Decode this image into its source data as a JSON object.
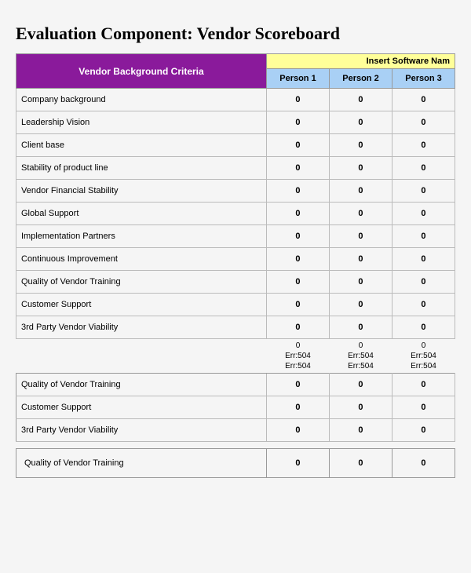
{
  "title": "Evaluation Component: Vendor Scoreboard",
  "header": {
    "criteria_label": "Vendor Background Criteria",
    "software_label": "Insert Software Nam",
    "persons": [
      "Person 1",
      "Person 2",
      "Person 3"
    ]
  },
  "section1_rows": [
    {
      "label": "Company background",
      "v": [
        "0",
        "0",
        "0"
      ]
    },
    {
      "label": "Leadership Vision",
      "v": [
        "0",
        "0",
        "0"
      ]
    },
    {
      "label": "Client base",
      "v": [
        "0",
        "0",
        "0"
      ]
    },
    {
      "label": "Stability of product line",
      "v": [
        "0",
        "0",
        "0"
      ]
    },
    {
      "label": "Vendor Financial Stability",
      "v": [
        "0",
        "0",
        "0"
      ]
    },
    {
      "label": "Global Support",
      "v": [
        "0",
        "0",
        "0"
      ]
    },
    {
      "label": "Implementation Partners",
      "v": [
        "0",
        "0",
        "0"
      ]
    },
    {
      "label": "Continuous Improvement",
      "v": [
        "0",
        "0",
        "0"
      ]
    },
    {
      "label": "Quality of Vendor Training",
      "v": [
        "0",
        "0",
        "0"
      ]
    },
    {
      "label": "Customer Support",
      "v": [
        "0",
        "0",
        "0"
      ]
    },
    {
      "label": "3rd Party Vendor Viability",
      "v": [
        "0",
        "0",
        "0"
      ]
    }
  ],
  "err_row": {
    "v": [
      "0\nErr:504\nErr:504",
      "0\nErr:504\nErr:504",
      "0\nErr:504\nErr:504"
    ]
  },
  "section2_rows": [
    {
      "label": "Quality of Vendor Training",
      "v": [
        "0",
        "0",
        "0"
      ]
    },
    {
      "label": "Customer Support",
      "v": [
        "0",
        "0",
        "0"
      ]
    },
    {
      "label": "3rd Party Vendor Viability",
      "v": [
        "0",
        "0",
        "0"
      ]
    }
  ],
  "section3_rows": [
    {
      "label": "Quality of Vendor Training",
      "v": [
        "0",
        "0",
        "0"
      ]
    }
  ]
}
